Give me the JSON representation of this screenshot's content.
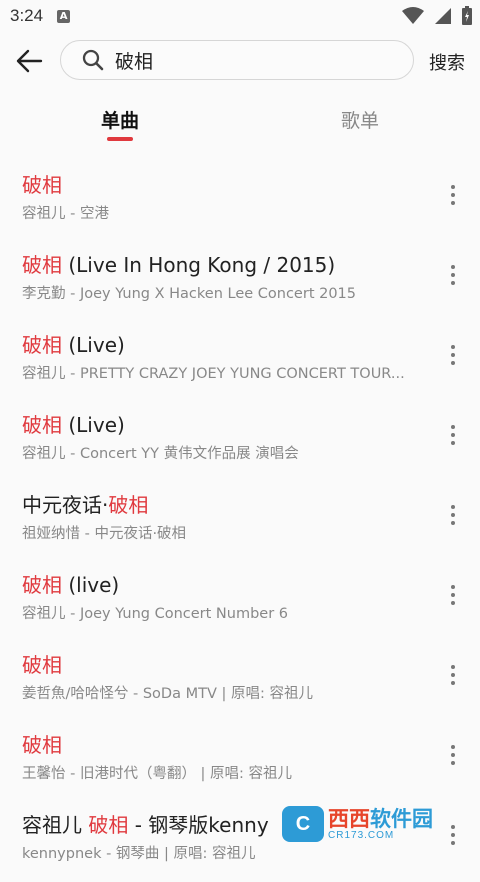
{
  "status_bar": {
    "time": "3:24",
    "notification_glyph": "A"
  },
  "search": {
    "query": "破相",
    "submit_label": "搜索"
  },
  "tabs": [
    {
      "label": "单曲",
      "active": true
    },
    {
      "label": "歌单",
      "active": false
    }
  ],
  "results": [
    {
      "before": "",
      "match": "破相",
      "after": "",
      "subtitle": "容祖儿 - 空港"
    },
    {
      "before": "",
      "match": "破相",
      "after": " (Live In Hong Kong / 2015)",
      "subtitle": "李克勤 - Joey Yung X Hacken Lee Concert 2015"
    },
    {
      "before": "",
      "match": "破相",
      "after": " (Live)",
      "subtitle": "容祖儿 - PRETTY CRAZY JOEY YUNG CONCERT TOUR..."
    },
    {
      "before": "",
      "match": "破相",
      "after": " (Live)",
      "subtitle": "容祖儿 - Concert YY 黄伟文作品展 演唱会"
    },
    {
      "before": "中元夜话·",
      "match": "破相",
      "after": "",
      "subtitle": "祖娅纳惜 - 中元夜话·破相"
    },
    {
      "before": "",
      "match": "破相",
      "after": " (live)",
      "subtitle": "容祖儿 - Joey Yung Concert Number 6"
    },
    {
      "before": "",
      "match": "破相",
      "after": "",
      "subtitle": "姜哲魚/哈哈怪兮 - SoDa MTV | 原唱: 容祖儿"
    },
    {
      "before": "",
      "match": "破相",
      "after": "",
      "subtitle": "王馨怡 - 旧港时代（粤翻） | 原唱: 容祖儿"
    },
    {
      "before": "容祖儿 ",
      "match": "破相",
      "after": " - 钢琴版kenny",
      "subtitle": "kennypnek - 钢琴曲 | 原唱: 容祖儿"
    }
  ],
  "watermark": {
    "badge": "C",
    "main_a": "西西",
    "main_b": "软件园",
    "url": "CR173.COM"
  },
  "colors": {
    "accent": "#e0393e",
    "background": "#fafafa",
    "subtitle": "#888888"
  }
}
